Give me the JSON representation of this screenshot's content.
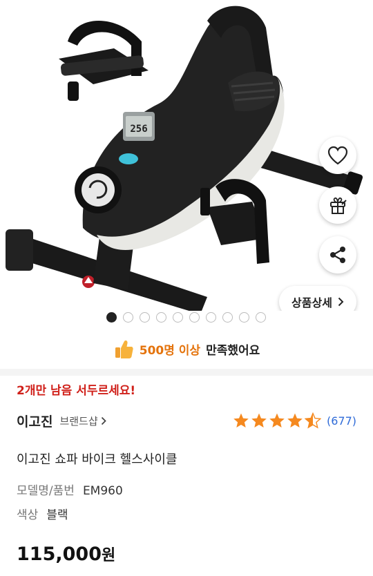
{
  "product": {
    "image_name": "pedal-exercise-bike",
    "display_text": "256",
    "satisfaction_count": "500명 이상",
    "satisfaction_rest": "만족했어요",
    "urgent_text": "2개만 남음 서두르세요!",
    "brand_name": "이고진",
    "brand_shop_label": "브랜드샵",
    "rating": 4.5,
    "review_count": "(677)",
    "title": "이고진 쇼파 바이크 헬스사이클",
    "model_label": "모델명/품번",
    "model_value": "EM960",
    "color_label": "색상",
    "color_value": "블랙",
    "price_value": "115,000",
    "price_unit": "원"
  },
  "actions": {
    "wishlist_icon": "heart-icon",
    "gift_icon": "gift-icon",
    "share_icon": "share-icon",
    "detail_label": "상품상세"
  },
  "gallery": {
    "total": 10,
    "current": 1
  },
  "colors": {
    "accent_orange": "#e4730c",
    "urgent_red": "#d0201a",
    "star": "#f5891f",
    "link_blue": "#2f6bd8"
  }
}
